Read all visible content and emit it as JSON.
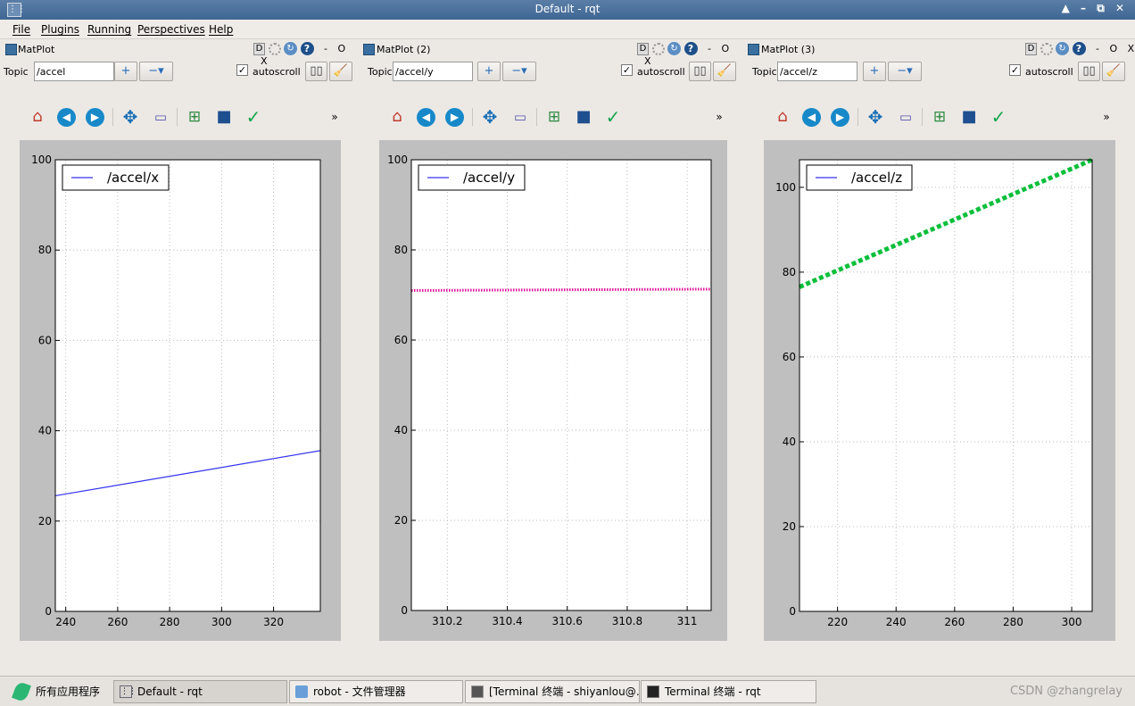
{
  "window": {
    "title": "Default - rqt",
    "controls": "▲ – ⧉ ✕"
  },
  "menu": [
    "File",
    "Plugins",
    "Running",
    "Perspectives",
    "Help"
  ],
  "panels": [
    {
      "title": "MatPlot",
      "topic": "/accel",
      "autoscroll": "autoscroll",
      "legend": "/accel/x"
    },
    {
      "title": "MatPlot (2)",
      "topic": "/accel/y",
      "autoscroll": "autoscroll",
      "legend": "/accel/y"
    },
    {
      "title": "MatPlot (3)",
      "topic": "/accel/z",
      "autoscroll": "autoscroll",
      "legend": "/accel/z"
    }
  ],
  "panel_controls": {
    "d": "D",
    "min": "-",
    "opt": "O",
    "close": "X",
    "topic_label": "Topic",
    "add": "+",
    "remove": "−▾",
    "pause": "▯▯"
  },
  "toolbar_icons": [
    "home-icon",
    "back-icon",
    "forward-icon",
    "pan-icon",
    "zoom-icon",
    "subplots-icon",
    "save-icon",
    "edit-icon"
  ],
  "chart_data": [
    {
      "type": "line",
      "title": "",
      "xlabel": "",
      "ylabel": "",
      "xlim": [
        236,
        338
      ],
      "ylim": [
        0,
        100
      ],
      "xticks": [
        240,
        260,
        280,
        300,
        320
      ],
      "yticks": [
        0,
        20,
        40,
        60,
        80,
        100
      ],
      "grid": true,
      "legend_position": "top-left",
      "series": [
        {
          "name": "/accel/x",
          "color": "#3333ee",
          "style": "solid",
          "x": [
            236,
            338
          ],
          "y": [
            25.6,
            35.6
          ]
        }
      ]
    },
    {
      "type": "line",
      "title": "",
      "xlabel": "",
      "ylabel": "",
      "xlim": [
        310.08,
        311.08
      ],
      "ylim": [
        0,
        100
      ],
      "xticks": [
        310.2,
        310.4,
        310.6,
        310.8,
        311.0
      ],
      "yticks": [
        0,
        20,
        40,
        60,
        80,
        100
      ],
      "grid": true,
      "legend_position": "top-left",
      "series": [
        {
          "name": "/accel/y",
          "color": "#dd1199",
          "style": "dotted",
          "x": [
            310.08,
            311.08
          ],
          "y": [
            71.0,
            71.3
          ]
        }
      ]
    },
    {
      "type": "line",
      "title": "",
      "xlabel": "",
      "ylabel": "",
      "xlim": [
        207,
        307
      ],
      "ylim": [
        0,
        106.5
      ],
      "xticks": [
        220,
        240,
        260,
        280,
        300
      ],
      "yticks": [
        0,
        20,
        40,
        60,
        80,
        100
      ],
      "grid": true,
      "legend_position": "top-left",
      "series": [
        {
          "name": "/accel/z",
          "color": "#0bbf3a",
          "style": "dashed",
          "x": [
            207,
            307
          ],
          "y": [
            76.5,
            106.5
          ]
        }
      ]
    }
  ],
  "taskbar": {
    "start": "所有应用程序",
    "tasks": [
      "Default - rqt",
      "robot - 文件管理器",
      "[Terminal 终端 - shiyanlou@…",
      "Terminal 终端 - rqt"
    ],
    "watermark": "CSDN @zhangrelay"
  }
}
